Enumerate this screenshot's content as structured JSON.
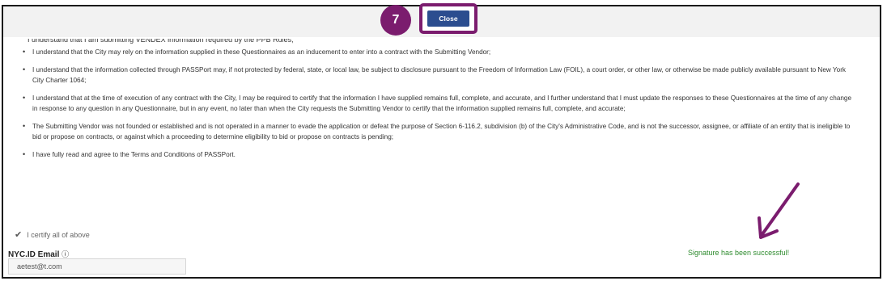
{
  "step_badge": "7",
  "close_label": "Close",
  "truncated_line": "I understand that I am submitting VENDEX information required by the PPB Rules;",
  "terms": [
    "I understand that the City may rely on the information supplied in these Questionnaires as an inducement to enter into a contract with the Submitting Vendor;",
    "I understand that the information collected through PASSPort may, if not protected by federal, state, or local law, be subject to disclosure pursuant to the Freedom of Information Law (FOIL), a court order, or other law, or otherwise be made publicly available pursuant to New York City Charter 1064;",
    "I understand that at the time of execution of any contract with the City, I may be required to certify that the information I have supplied remains full, complete, and accurate, and I further understand that I must update the responses to these Questionnaires at the time of any change in response to any question in any Questionnaire, but in any event, no later than when the City requests the Submitting Vendor to certify that the information supplied remains full, complete, and accurate;",
    "The Submitting Vendor was not founded or established and is not operated in a manner to evade the application or defeat the purpose of Section 6-116.2, subdivision (b) of the City's Administrative Code, and is not the successor, assignee, or affiliate of an entity that is ineligible to bid or propose on contracts, or against which a proceeding to determine eligibility to bid or propose on contracts is pending;",
    "I have fully read and agree to the Terms and Conditions of PASSPort."
  ],
  "certify_label": "I certify all of above",
  "email_label": "NYC.ID Email",
  "email_info_icon": "info-icon",
  "email_value": "aetest@t.com",
  "success_message": "Signature has been successful!",
  "colors": {
    "accent": "#7b1c6e",
    "button": "#2b4d8f",
    "success": "#2e8b2e"
  }
}
